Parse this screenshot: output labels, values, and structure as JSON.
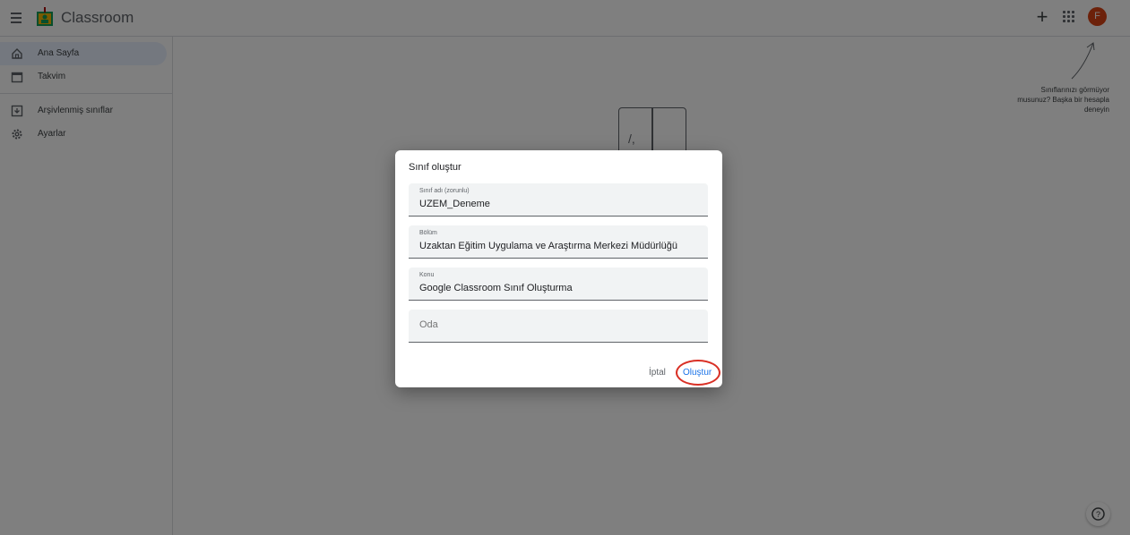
{
  "header": {
    "app_title": "Classroom",
    "menu_icon": "hamburger-icon",
    "add_icon": "plus-icon",
    "apps_icon": "apps-grid-icon",
    "avatar_initial": "F",
    "avatar_color": "#d84315"
  },
  "sidebar": {
    "items": [
      {
        "label": "Ana Sayfa",
        "icon": "home-icon",
        "active": true
      },
      {
        "label": "Takvim",
        "icon": "calendar-icon",
        "active": false
      },
      {
        "label": "Arşivlenmiş sınıflar",
        "icon": "archive-icon",
        "active": false
      },
      {
        "label": "Ayarlar",
        "icon": "gear-icon",
        "active": false
      }
    ]
  },
  "hint": {
    "text": "Sınıflarınızı görmüyor musunuz? Başka bir hesapla deneyin"
  },
  "dialog": {
    "title": "Sınıf oluştur",
    "fields": [
      {
        "label": "Sınıf adı (zorunlu)",
        "value": "UZEM_Deneme"
      },
      {
        "label": "Bölüm",
        "value": "Uzaktan Eğitim Uygulama ve Araştırma Merkezi Müdürlüğü"
      },
      {
        "label": "Konu",
        "value": "Google Classroom Sınıf Oluşturma"
      },
      {
        "label": "",
        "placeholder": "Oda",
        "value": ""
      }
    ],
    "cancel_label": "İptal",
    "create_label": "Oluştur"
  },
  "colors": {
    "accent": "#1a73e8",
    "highlight": "#d93025",
    "scrim": "rgba(0,0,0,0.5)"
  }
}
